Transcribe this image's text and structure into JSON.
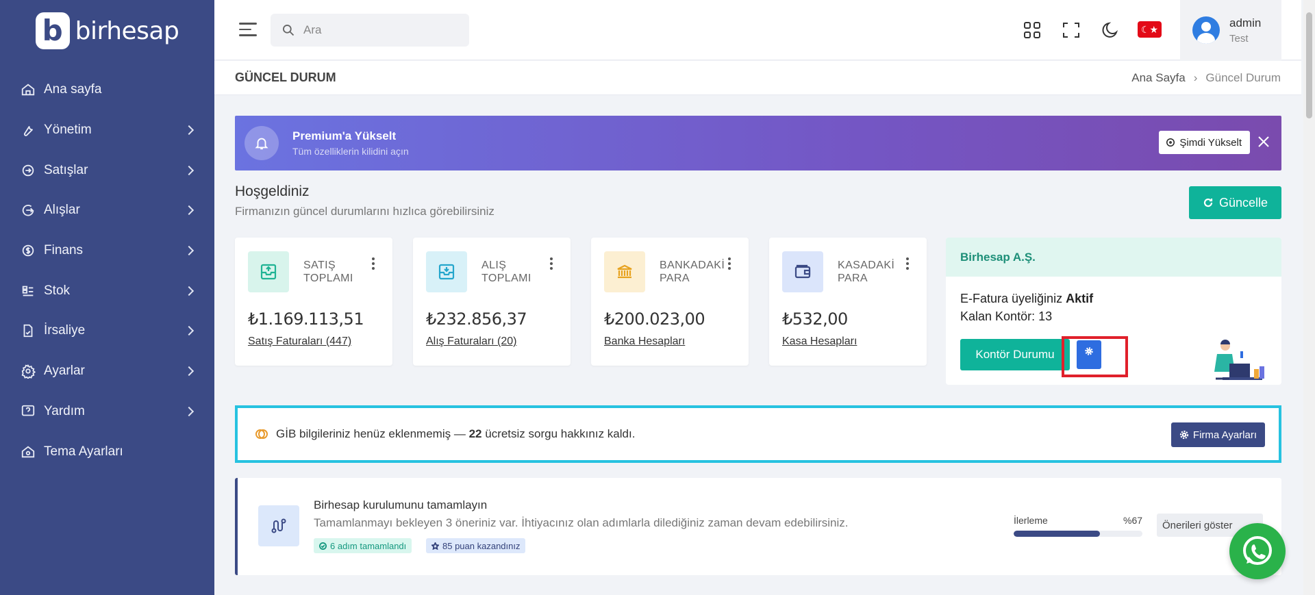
{
  "brand": {
    "name": "birhesap",
    "mark": "b"
  },
  "sidebar": {
    "items": [
      {
        "label": "Ana sayfa",
        "icon": "home-icon",
        "has_children": false
      },
      {
        "label": "Yönetim",
        "icon": "wrench-icon",
        "has_children": true
      },
      {
        "label": "Satışlar",
        "icon": "sales-icon",
        "has_children": true
      },
      {
        "label": "Alışlar",
        "icon": "purchases-icon",
        "has_children": true
      },
      {
        "label": "Finans",
        "icon": "dollar-icon",
        "has_children": true
      },
      {
        "label": "Stok",
        "icon": "stock-icon",
        "has_children": true
      },
      {
        "label": "İrsaliye",
        "icon": "document-icon",
        "has_children": true
      },
      {
        "label": "Ayarlar",
        "icon": "gear-icon",
        "has_children": true
      },
      {
        "label": "Yardım",
        "icon": "help-icon",
        "has_children": true
      },
      {
        "label": "Tema Ayarları",
        "icon": "theme-icon",
        "has_children": false
      }
    ]
  },
  "topbar": {
    "search_placeholder": "Ara",
    "user": {
      "name": "admin",
      "role": "Test"
    },
    "flag": "☾★"
  },
  "page": {
    "title": "GÜNCEL DURUM",
    "breadcrumb": {
      "home": "Ana Sayfa",
      "sep": "›",
      "current": "Güncel Durum"
    }
  },
  "premium": {
    "title": "Premium'a Yükselt",
    "subtitle": "Tüm özelliklerin kilidini açın",
    "button": "Şimdi Yükselt"
  },
  "welcome": {
    "title": "Hoşgeldiniz",
    "subtitle": "Firmanızın güncel durumlarını hızlıca görebilirsiniz",
    "refresh_button": "Güncelle"
  },
  "stats": [
    {
      "label": "SATIŞ TOPLAMI",
      "value": "₺1.169.113,51",
      "link": "Satış Faturaları (447)",
      "color": "#1fb394",
      "bg": "#d8f4ec"
    },
    {
      "label": "ALIŞ TOPLAMI",
      "value": "₺232.856,37",
      "link": "Alış Faturaları (20)",
      "color": "#24a6cc",
      "bg": "#d8f1f8"
    },
    {
      "label": "BANKADAKİ PARA",
      "value": "₺200.023,00",
      "link": "Banka Hesapları",
      "color": "#e7a21e",
      "bg": "#fcefd2"
    },
    {
      "label": "KASADAKİ PARA",
      "value": "₺532,00",
      "link": "Kasa Hesapları",
      "color": "#3b4a85",
      "bg": "#dbe5fb"
    }
  ],
  "company": {
    "name": "Birhesap A.Ş.",
    "efatura_prefix": "E-Fatura üyeliğiniz",
    "efatura_status": "Aktif",
    "kontor_line": "Kalan Kontör: 13",
    "kontor_button": "Kontör Durumu"
  },
  "gib": {
    "text_prefix": "GİB bilgileriniz henüz eklenmemiş —",
    "count": "22",
    "text_suffix": "ücretsiz sorgu hakkınız kaldı.",
    "button": "Firma Ayarları"
  },
  "setup": {
    "title": "Birhesap kurulumunu tamamlayın",
    "description": "Tamamlanmayı bekleyen 3 öneriniz var. İhtiyacınız olan adımlarla dilediğiniz zaman devam edebilirsiniz.",
    "badge_steps": "6 adım tamamlandı",
    "badge_points": "85 puan kazandınız",
    "progress_label": "İlerleme",
    "progress_text": "%67",
    "progress_value": 67,
    "suggest_button": "Önerileri göster"
  },
  "colors": {
    "sidebar": "#3b4a85",
    "accent_green": "#0fb39a",
    "accent_cyan": "#27c2e0",
    "highlight_red": "#e0202b"
  }
}
